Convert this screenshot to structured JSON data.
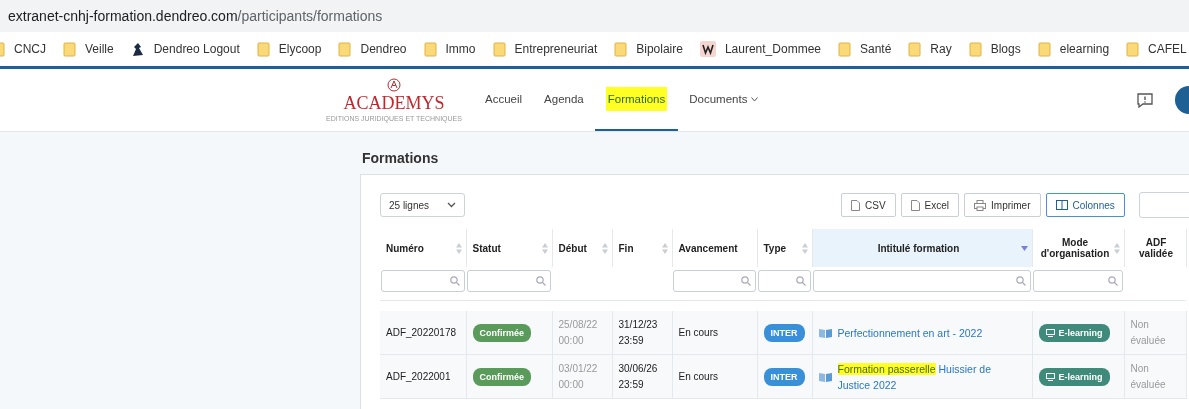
{
  "address_bar": {
    "host": "extranet-cnhj-formation.dendreo.com",
    "path": "/participants/formations"
  },
  "bookmarks": [
    {
      "label": "CNCJ",
      "kind": "folder"
    },
    {
      "label": "Veille",
      "kind": "folder"
    },
    {
      "label": "Dendreo Logout",
      "kind": "app"
    },
    {
      "label": "Elycoop",
      "kind": "folder"
    },
    {
      "label": "Dendreo",
      "kind": "folder"
    },
    {
      "label": "Immo",
      "kind": "folder"
    },
    {
      "label": "Entrepreneuriat",
      "kind": "folder"
    },
    {
      "label": "Bipolaire",
      "kind": "folder"
    },
    {
      "label": "Laurent_Dommee",
      "kind": "page"
    },
    {
      "label": "Santé",
      "kind": "folder"
    },
    {
      "label": "Ray",
      "kind": "folder"
    },
    {
      "label": "Blogs",
      "kind": "folder"
    },
    {
      "label": "elearning",
      "kind": "folder"
    },
    {
      "label": "CAFEL",
      "kind": "folder"
    }
  ],
  "logo": {
    "name": "ACADEMYS",
    "tagline": "EDITIONS JURIDIQUES ET TECHNIQUES"
  },
  "nav": [
    {
      "label": "Accueil",
      "selected": false,
      "highlighted": false,
      "has_menu": false
    },
    {
      "label": "Agenda",
      "selected": false,
      "highlighted": false,
      "has_menu": false
    },
    {
      "label": "Formations",
      "selected": true,
      "highlighted": true,
      "has_menu": false
    },
    {
      "label": "Documents",
      "selected": false,
      "highlighted": false,
      "has_menu": true
    }
  ],
  "page_title": "Formations",
  "toolbar": {
    "page_size": "25 lignes",
    "buttons": [
      {
        "label": "CSV",
        "kind": "csv",
        "active": false
      },
      {
        "label": "Excel",
        "kind": "excel",
        "active": false
      },
      {
        "label": "Imprimer",
        "kind": "print",
        "active": false
      },
      {
        "label": "Colonnes",
        "kind": "columns",
        "active": true
      }
    ]
  },
  "table": {
    "columns": [
      {
        "label": "Numéro",
        "sortable": true,
        "sorted": false,
        "filter": true
      },
      {
        "label": "Statut",
        "sortable": true,
        "sorted": false,
        "filter": true
      },
      {
        "label": "Début",
        "sortable": true,
        "sorted": false,
        "filter": false
      },
      {
        "label": "Fin",
        "sortable": true,
        "sorted": false,
        "filter": false
      },
      {
        "label": "Avancement",
        "sortable": false,
        "sorted": false,
        "filter": true
      },
      {
        "label": "Type",
        "sortable": true,
        "sorted": false,
        "filter": true
      },
      {
        "label": "Intitulé formation",
        "sortable": true,
        "sorted": true,
        "filter": true
      },
      {
        "label": "Mode d'organisation",
        "sortable": true,
        "sorted": false,
        "filter": true
      },
      {
        "label": "ADF validée",
        "sortable": false,
        "sorted": false,
        "filter": false
      }
    ],
    "rows": [
      {
        "number": "ADF_20220178",
        "status": "Confirmée",
        "start": [
          "25/08/22",
          "00:00"
        ],
        "end": [
          "31/12/23",
          "23:59"
        ],
        "progress": "En cours",
        "type": "INTER",
        "title": [
          {
            "text": "Perfectionnement en art - 2022",
            "highlighted": false
          }
        ],
        "mode": "E-learning",
        "adf": [
          "Non",
          "évaluée"
        ]
      },
      {
        "number": "ADF_2022001",
        "status": "Confirmée",
        "start": [
          "03/01/22",
          "00:00"
        ],
        "end": [
          "30/06/26",
          "23:59"
        ],
        "progress": "En cours",
        "type": "INTER",
        "title": [
          {
            "text": "Formation passerelle",
            "highlighted": true
          },
          {
            "text": " Huissier de Justice 2022",
            "highlighted": false
          }
        ],
        "mode": "E-learning",
        "adf": [
          "Non",
          "évaluée"
        ]
      }
    ]
  }
}
